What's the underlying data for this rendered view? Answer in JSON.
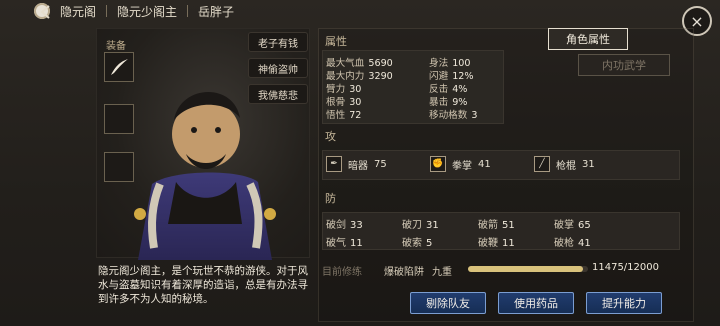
{
  "header": {
    "crumbs": [
      "隐元阁",
      "隐元少阁主",
      "岳胖子"
    ]
  },
  "left": {
    "equip_label": "装备",
    "titles": [
      "老子有钱",
      "神偷盗帅",
      "我佛慈悲"
    ],
    "bio": "隐元阁少阁主，是个玩世不恭的游侠。对于风水与盗墓知识有着深厚的造诣，总是有办法寻到许多不为人知的秘境。"
  },
  "tabs": {
    "attributes": "角色属性",
    "martial": "内功武学"
  },
  "attributes": {
    "title": "属性",
    "items": [
      {
        "label": "最大气血",
        "value": "5690"
      },
      {
        "label": "最大内力",
        "value": "3290"
      },
      {
        "label": "臂力",
        "value": "30"
      },
      {
        "label": "根骨",
        "value": "30"
      },
      {
        "label": "悟性",
        "value": "72"
      }
    ],
    "right": [
      {
        "label": "身法",
        "value": "100"
      },
      {
        "label": "闪避",
        "value": "12%"
      },
      {
        "label": "反击",
        "value": "4%"
      },
      {
        "label": "暴击",
        "value": "9%"
      },
      {
        "label": "移动格数",
        "value": "3"
      }
    ]
  },
  "attack": {
    "title": "攻",
    "items": [
      {
        "name": "暗器",
        "value": "75",
        "icon": "dart-icon"
      },
      {
        "name": "拳掌",
        "value": "41",
        "icon": "fist-icon"
      },
      {
        "name": "枪棍",
        "value": "31",
        "icon": "spear-icon"
      }
    ]
  },
  "defense": {
    "title": "防",
    "rows": [
      [
        {
          "label": "破剑",
          "value": "33"
        },
        {
          "label": "破刀",
          "value": "31"
        },
        {
          "label": "破箭",
          "value": "51"
        },
        {
          "label": "破掌",
          "value": "65"
        }
      ],
      [
        {
          "label": "破气",
          "value": "11"
        },
        {
          "label": "破索",
          "value": "5"
        },
        {
          "label": "破鞭",
          "value": "11"
        },
        {
          "label": "破枪",
          "value": "41"
        }
      ]
    ]
  },
  "cultivation": {
    "label": "目前修练",
    "skill": "爆破陷阱",
    "level": "九重",
    "progress_text": "11475/12000",
    "progress_fraction": 0.956
  },
  "buttons": {
    "remove": "剔除队友",
    "use_item": "使用药品",
    "upgrade": "提升能力"
  },
  "colors": {
    "accent": "#d9c27c",
    "button": "#1b3766"
  }
}
